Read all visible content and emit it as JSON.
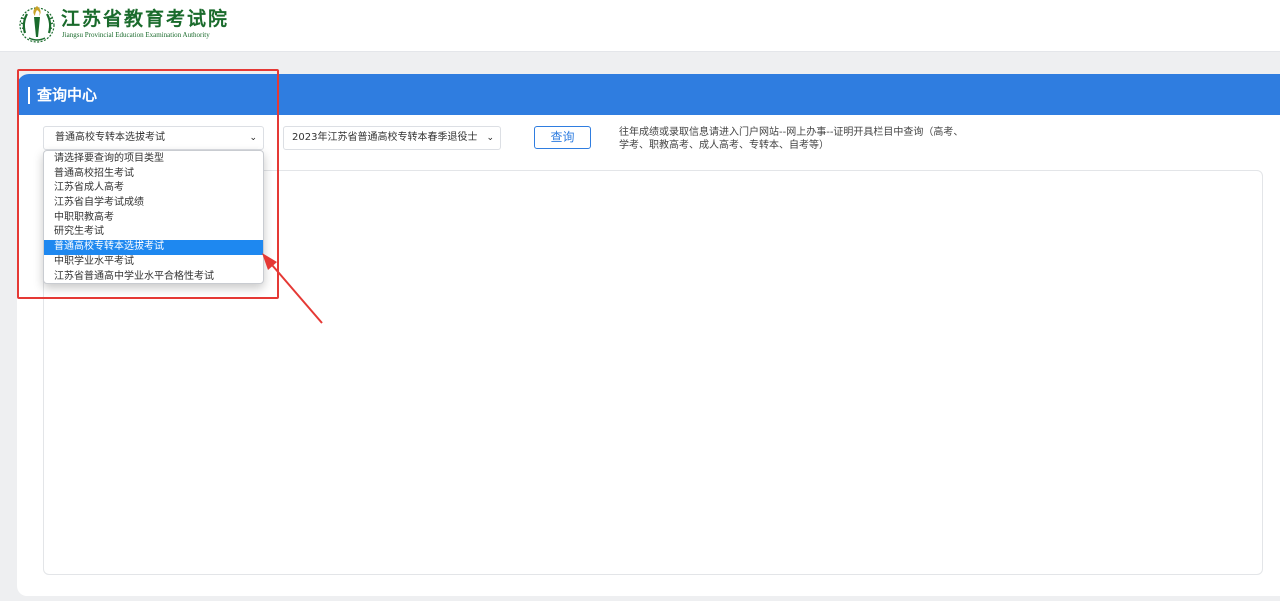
{
  "header": {
    "logo_cn": "江苏省教育考试院",
    "logo_en": "Jiangsu Provincial Education Examination Authority"
  },
  "panel": {
    "title": "查询中心"
  },
  "filters": {
    "type_selected": "普通高校专转本选拔考试",
    "batch_selected": "2023年江苏省普通高校专转本春季退役士",
    "query_button": "查询",
    "tip_line1": "往年成绩或录取信息请进入门户网站--网上办事--证明开具栏目中查询（高考、",
    "tip_line2": "学考、职教高考、成人高考、专转本、自考等）"
  },
  "dropdown": {
    "options": [
      "请选择要查询的项目类型",
      "普通高校招生考试",
      "江苏省成人高考",
      "江苏省自学考试成绩",
      "中职职教高考",
      "研究生考试",
      "普通高校专转本选拔考试",
      "中职学业水平考试",
      "江苏省普通高中学业水平合格性考试"
    ],
    "selected_index": 6
  },
  "colors": {
    "brand_green": "#1a6b2c",
    "header_blue": "#2f7de0",
    "selected_blue": "#1e88f0",
    "annotation_red": "#e53935"
  },
  "icons": {
    "logo": "torch-wreath-emblem-icon",
    "caret": "chevron-down-icon",
    "annotation": "red-arrow-icon"
  }
}
